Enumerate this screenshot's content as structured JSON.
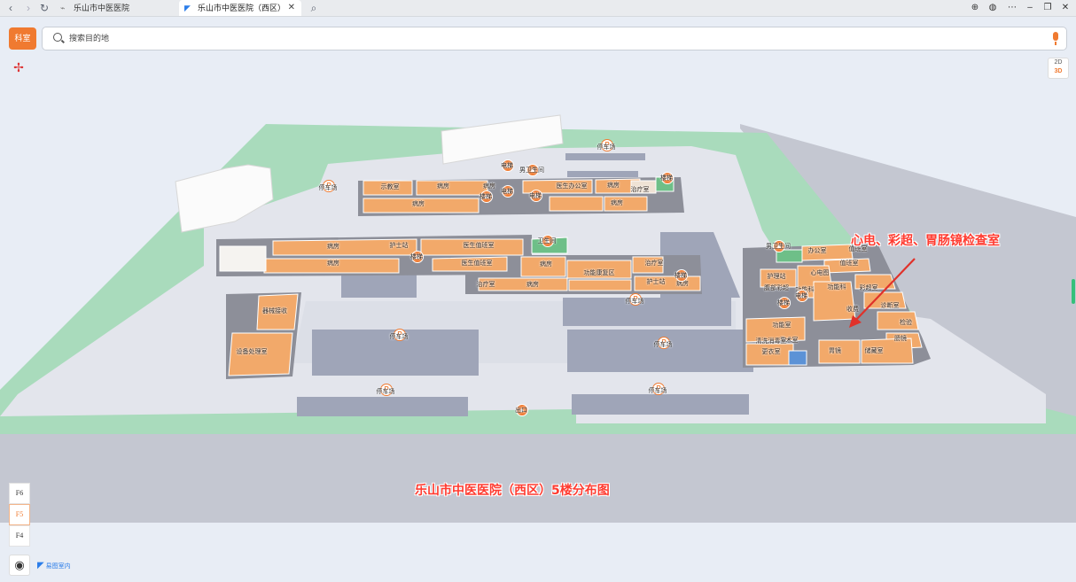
{
  "browser": {
    "tabs": [
      {
        "title": "乐山市中医医院",
        "active": false
      },
      {
        "title": "乐山市中医医院（西区）",
        "active": true
      }
    ]
  },
  "toolbar": {
    "category_button": "科室",
    "search_placeholder": "搜索目的地",
    "view_toggle_2d": "2D",
    "view_toggle_3d": "3D"
  },
  "floors": [
    "F6",
    "F5",
    "F4"
  ],
  "active_floor": "F5",
  "brand": "易图室内",
  "map": {
    "rooms": {
      "r1": "病房",
      "r2": "示教室",
      "r3": "病房",
      "r4": "病房",
      "r5": "医生办公室",
      "r6": "病房",
      "r7": "病房",
      "r8": "护士站",
      "r9": "病房",
      "r10": "医生值班室",
      "r11": "医生值班室",
      "r12": "治疗室",
      "r13": "病房",
      "r14": "病房",
      "r15": "功能康复区",
      "r16": "治疗室",
      "r17": "病房",
      "r18": "护士站",
      "r19": "病房",
      "r20": "治疗室",
      "r21": "器械接收",
      "r22": "设备处理室",
      "r23": "办公室",
      "r24": "值班室",
      "r25": "心电图",
      "r26": "值班室",
      "r27": "功能科",
      "r28": "彩超室",
      "r29": "收费",
      "r30": "诊断室",
      "r31": "检验",
      "r32": "护理站",
      "r33": "腹部彩超",
      "r34": "功能科",
      "r35": "功能室",
      "r36": "胃镜",
      "r37": "储藏室",
      "r38": "肠镜",
      "r39": "手术室",
      "r40": "更衣室",
      "r41": "清洗消毒室"
    },
    "pois": {
      "p1": "电梯",
      "p2": "男卫生间",
      "p3": "电梯",
      "p4": "楼梯",
      "p5": "电梯",
      "p6": "楼梯",
      "p7": "卫生间",
      "p8": "楼梯",
      "p9": "楼梯",
      "p10": "楼梯",
      "p11": "电梯",
      "p12": "男卫生间",
      "p13": "出口"
    },
    "parking": {
      "k1": "停车场",
      "k2": "停车场",
      "k3": "停车场",
      "k4": "停车场",
      "k5": "停车场",
      "k6": "停车场",
      "k7": "停车场"
    },
    "callout": "心电、彩超、胃肠镜检查室",
    "caption": "乐山市中医医院（西区）5楼分布图"
  }
}
